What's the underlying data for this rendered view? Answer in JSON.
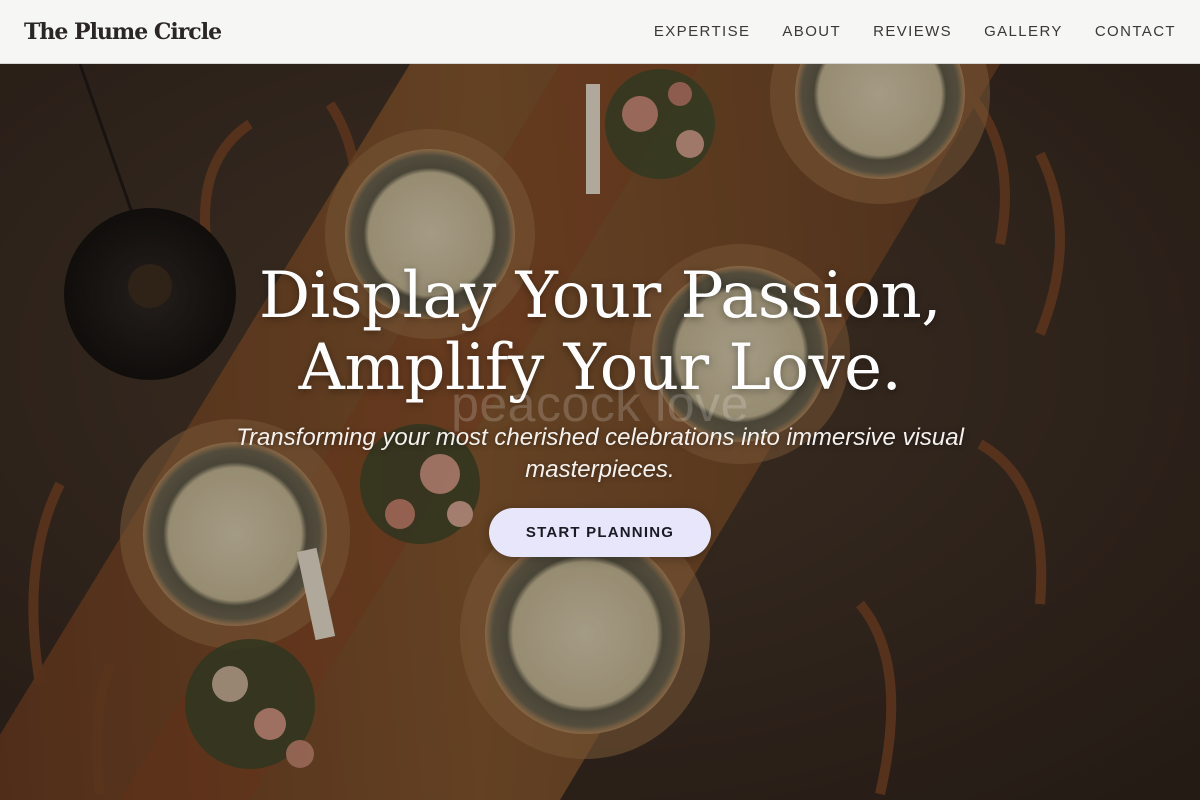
{
  "header": {
    "brand": "The Plume Circle",
    "nav": [
      "EXPERTISE",
      "ABOUT",
      "REVIEWS",
      "GALLERY",
      "CONTACT"
    ]
  },
  "hero": {
    "title_line1": "Display Your Passion,",
    "title_line2": "Amplify Your Love.",
    "watermark": "peacock love",
    "subtitle": "Transforming your most cherished celebrations into immersive visual masterpieces.",
    "cta_label": "START PLANNING",
    "background": "overhead photo of a candlelit dinner table with plates, flowers and chairs"
  },
  "colors": {
    "header_bg": "#f6f6f5",
    "nav_text": "#3b3835",
    "cta_bg": "#e8e6fb",
    "hero_text": "#ffffff"
  }
}
